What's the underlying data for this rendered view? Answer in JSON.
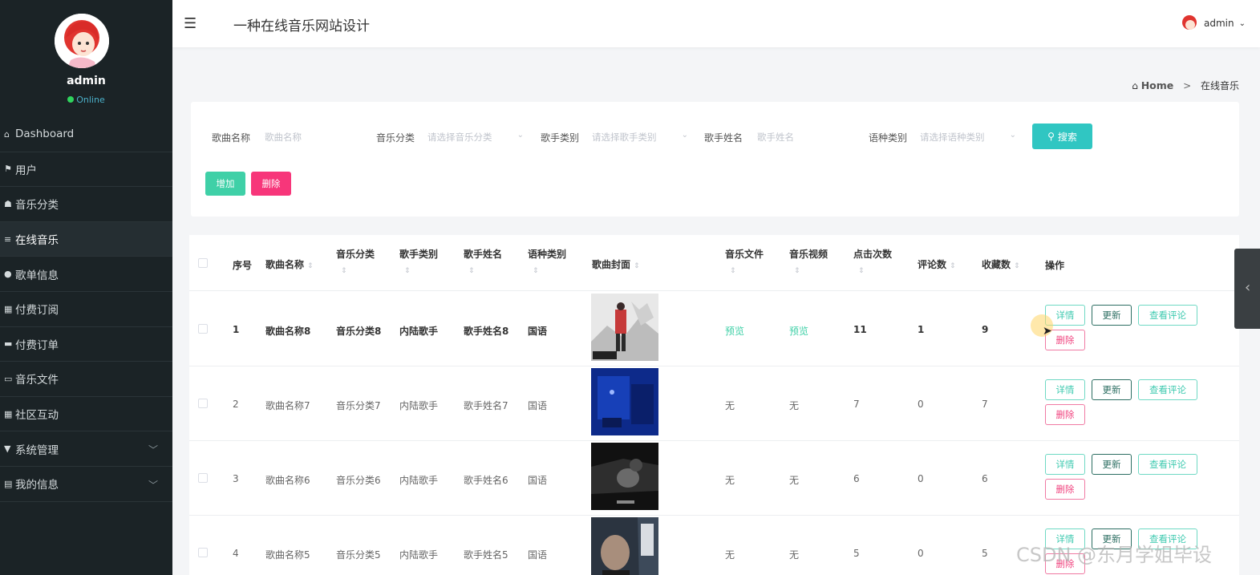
{
  "sidebar": {
    "username": "admin",
    "status": "Online",
    "items": [
      {
        "label": "Dashboard",
        "icon": "home-icon"
      },
      {
        "label": "用户",
        "icon": "flag-icon"
      },
      {
        "label": "音乐分类",
        "icon": "tag-icon"
      },
      {
        "label": "在线音乐",
        "icon": "sliders-icon"
      },
      {
        "label": "歌单信息",
        "icon": "pin-icon"
      },
      {
        "label": "付费订阅",
        "icon": "grid-icon"
      },
      {
        "label": "付费订单",
        "icon": "monitor-icon"
      },
      {
        "label": "音乐文件",
        "icon": "ticket-icon"
      },
      {
        "label": "社区互动",
        "icon": "grid-icon"
      },
      {
        "label": "系统管理",
        "icon": "filter-icon"
      },
      {
        "label": "我的信息",
        "icon": "card-icon"
      }
    ]
  },
  "header": {
    "title": "一种在线音乐网站设计",
    "user": "admin"
  },
  "breadcrumb": {
    "home": "Home",
    "separator": ">",
    "current": "在线音乐"
  },
  "search": {
    "song_label": "歌曲名称",
    "song_placeholder": "歌曲名称",
    "category_label": "音乐分类",
    "category_placeholder": "请选择音乐分类",
    "singer_type_label": "歌手类别",
    "singer_type_placeholder": "请选择歌手类别",
    "singer_label": "歌手姓名",
    "singer_placeholder": "歌手姓名",
    "language_label": "语种类别",
    "language_placeholder": "请选择语种类别",
    "search_button": "搜索",
    "add_button": "增加",
    "delete_button": "删除"
  },
  "table": {
    "headers": {
      "index": "序号",
      "song": "歌曲名称",
      "category": "音乐分类",
      "singer_type": "歌手类别",
      "singer": "歌手姓名",
      "language": "语种类别",
      "cover": "歌曲封面",
      "file": "音乐文件",
      "video": "音乐视频",
      "clicks": "点击次数",
      "comments": "评论数",
      "favorites": "收藏数",
      "actions": "操作"
    },
    "actions": {
      "detail": "详情",
      "update": "更新",
      "view_comments": "查看评论",
      "delete": "删除"
    },
    "rows": [
      {
        "index": "1",
        "song": "歌曲名称8",
        "category": "音乐分类8",
        "singer_type": "内陆歌手",
        "singer": "歌手姓名8",
        "language": "国语",
        "file": "预览",
        "video": "预览",
        "clicks": "11",
        "comments": "1",
        "favorites": "9"
      },
      {
        "index": "2",
        "song": "歌曲名称7",
        "category": "音乐分类7",
        "singer_type": "内陆歌手",
        "singer": "歌手姓名7",
        "language": "国语",
        "file": "无",
        "video": "无",
        "clicks": "7",
        "comments": "0",
        "favorites": "7"
      },
      {
        "index": "3",
        "song": "歌曲名称6",
        "category": "音乐分类6",
        "singer_type": "内陆歌手",
        "singer": "歌手姓名6",
        "language": "国语",
        "file": "无",
        "video": "无",
        "clicks": "6",
        "comments": "0",
        "favorites": "6"
      },
      {
        "index": "4",
        "song": "歌曲名称5",
        "category": "音乐分类5",
        "singer_type": "内陆歌手",
        "singer": "歌手姓名5",
        "language": "国语",
        "file": "无",
        "video": "无",
        "clicks": "5",
        "comments": "0",
        "favorites": "5"
      }
    ]
  },
  "watermark": "CSDN @东月学姐毕设",
  "colors": {
    "sidebar_bg": "#1b2326",
    "accent_teal": "#30c6c2",
    "add_green": "#3fd0a7",
    "delete_pink": "#f7367a"
  }
}
